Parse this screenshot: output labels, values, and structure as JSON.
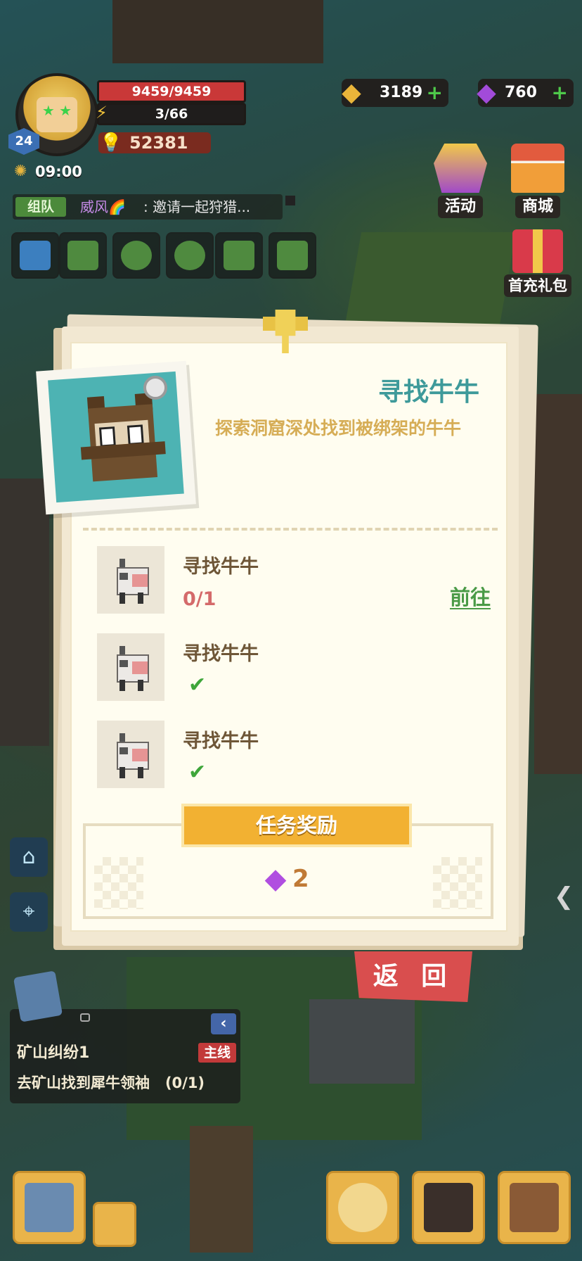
{
  "player": {
    "level": "24",
    "hp": "9459/9459",
    "energy": "3/66",
    "power": "52381",
    "time": "09:00"
  },
  "currency": {
    "gold": "3189",
    "gems": "760",
    "plus": "+"
  },
  "shop": {
    "activity": "活动",
    "store": "商城",
    "first_recharge": "首充礼包"
  },
  "chat": {
    "channel": "组队",
    "user": "威风🌈",
    "message": ": 邀请一起狩猎..."
  },
  "dialog": {
    "title": "寻找牛牛",
    "description": "探索洞窟深处找到被绑架的牛牛",
    "tasks": [
      {
        "name": "寻找牛牛",
        "progress": "0/1",
        "action": "前往",
        "done": false
      },
      {
        "name": "寻找牛牛",
        "done": true
      },
      {
        "name": "寻找牛牛",
        "done": true
      }
    ],
    "reward_title": "任务奖励",
    "reward_count": "2",
    "reward_icon": "gem-icon",
    "back_label": "返 回"
  },
  "quest": {
    "name": "矿山纠纷1",
    "tag": "主线",
    "description": "去矿山找到犀牛领袖",
    "progress": "(0/1)"
  },
  "colors": {
    "accent_teal": "#3e9a9a",
    "reward_orange": "#f2b132",
    "back_red": "#d94e4e",
    "done_green": "#3fa63a"
  }
}
